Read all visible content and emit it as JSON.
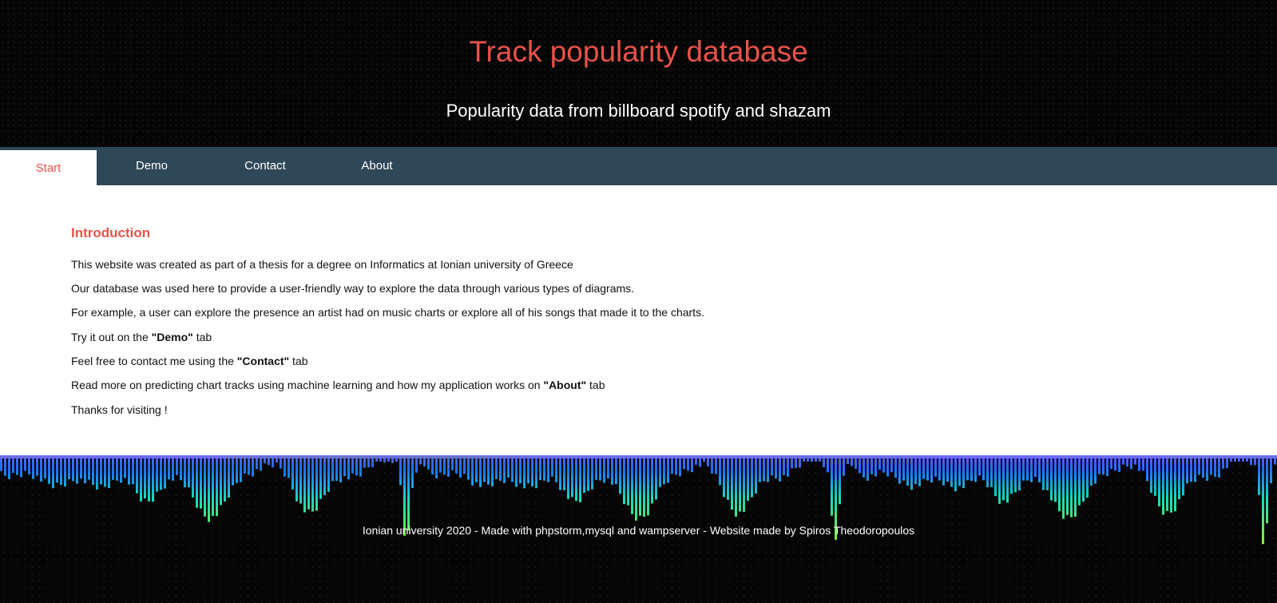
{
  "header": {
    "title": "Track popularity database",
    "subtitle": "Popularity data from billboard spotify and shazam"
  },
  "nav": {
    "tabs": [
      {
        "label": "Start",
        "active": true
      },
      {
        "label": "Demo",
        "active": false
      },
      {
        "label": "Contact",
        "active": false
      },
      {
        "label": "About",
        "active": false
      }
    ]
  },
  "content": {
    "heading": "Introduction",
    "paragraphs": [
      {
        "pre": "This website was created as part of a thesis for a degree on Informatics at Ionian university of Greece"
      },
      {
        "pre": "Our database was used here to provide a user-friendly way to explore the data through various types of diagrams."
      },
      {
        "pre": "For example, a user can explore the presence an artist had on music charts or explore all of his songs that made it to the charts."
      },
      {
        "pre": "Try it out on the ",
        "bold": "\"Demo\"",
        "post": " tab"
      },
      {
        "pre": "Feel free to contact me using the ",
        "bold": "\"Contact\"",
        "post": " tab"
      },
      {
        "pre": "Read more on predicting chart tracks using machine learning and how my application works on ",
        "bold": "\"About\"",
        "post": " tab"
      },
      {
        "pre": "Thanks for visiting !"
      }
    ]
  },
  "footer": {
    "text": "Ionian university 2020 - Made with phpstorm,mysql and wampserver - Website made by Spiros Theodoropoulos"
  },
  "colors": {
    "accent": "#e8524a",
    "nav_background": "#2f4858",
    "visualizer_top": "#1e6fff",
    "visualizer_mid": "#18d6c0",
    "visualizer_bottom": "#7cf23a"
  }
}
